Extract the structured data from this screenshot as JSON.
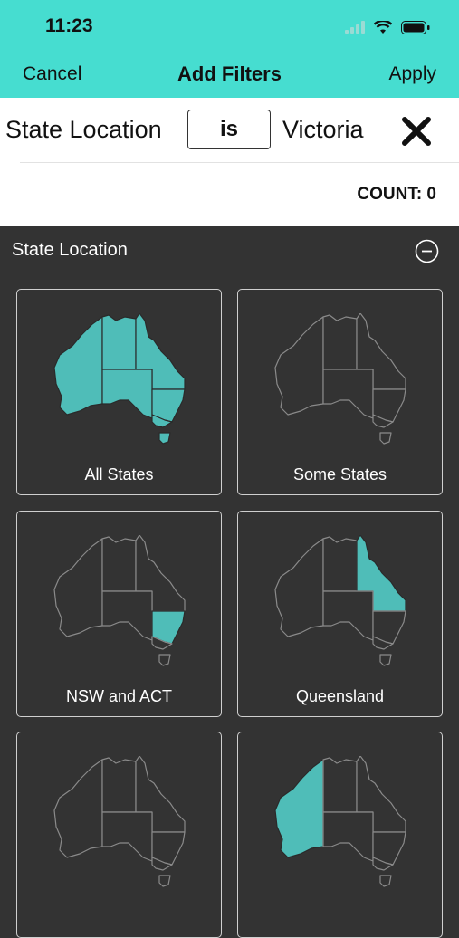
{
  "status": {
    "time": "11:23"
  },
  "nav": {
    "cancel": "Cancel",
    "title": "Add Filters",
    "apply": "Apply"
  },
  "filter": {
    "field": "State Location",
    "operator": "is",
    "value": "Victoria",
    "count": "COUNT: 0"
  },
  "section": {
    "title": "State Location"
  },
  "cards": [
    {
      "label": "All States",
      "highlight": "all"
    },
    {
      "label": "Some States",
      "highlight": "none"
    },
    {
      "label": "NSW and ACT",
      "highlight": "nsw"
    },
    {
      "label": "Queensland",
      "highlight": "qld"
    },
    {
      "label": "",
      "highlight": "none"
    },
    {
      "label": "",
      "highlight": "wa"
    }
  ],
  "colors": {
    "accent": "#46ddd0",
    "panel": "#333333",
    "map_fill": "#4fbdb8",
    "map_outline": "#8a8a8a"
  }
}
